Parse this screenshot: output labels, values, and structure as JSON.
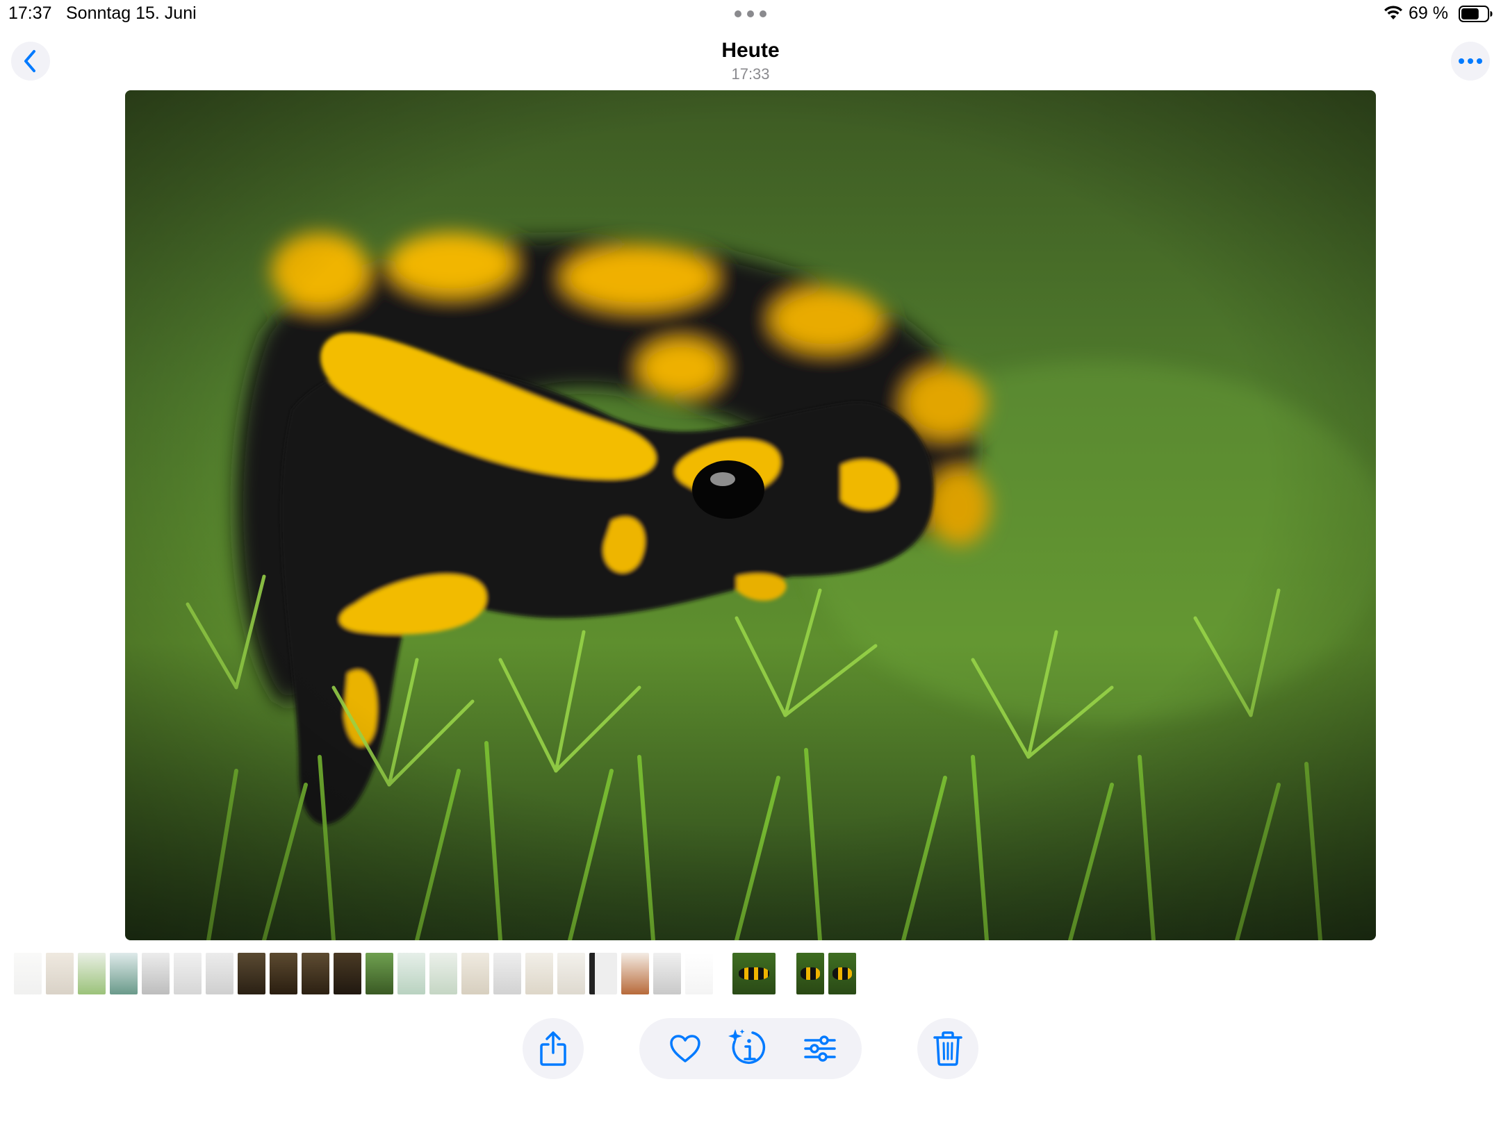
{
  "status_bar": {
    "time": "17:37",
    "date": "Sonntag 15. Juni",
    "battery_percent": "69 %",
    "battery_level": 0.69,
    "wifi_icon": "wifi-icon"
  },
  "nav": {
    "title": "Heute",
    "subtitle": "17:33",
    "back_icon": "chevron-left-icon",
    "more_icon": "ellipsis-icon"
  },
  "accent_color": "#007aff",
  "toolbar": {
    "share_icon": "share-icon",
    "like_icon": "heart-icon",
    "info_icon": "sparkle-info-icon",
    "adjust_icon": "sliders-icon",
    "delete_icon": "trash-icon"
  },
  "thumbnail_count": 25
}
